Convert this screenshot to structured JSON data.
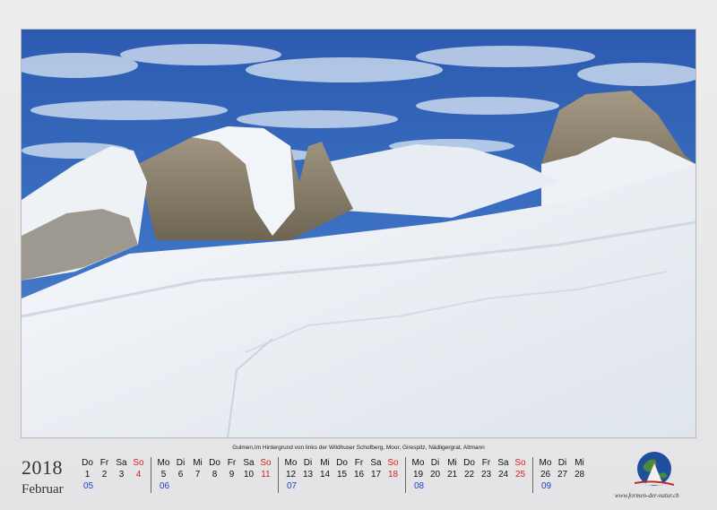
{
  "caption": "Gulmen,Im Hintergrund von links der Wildhuser Schofberg, Moor, Girespitz, Nädligergrat, Altmann",
  "year": "2018",
  "month": "Februar",
  "website": "www.formen-der-natur.ch",
  "colors": {
    "sunday": "#d91f1f",
    "week_number": "#1e3fc8"
  },
  "weeks": [
    {
      "week": "05",
      "days": [
        {
          "d": "Do",
          "n": "1"
        },
        {
          "d": "Fr",
          "n": "2"
        },
        {
          "d": "Sa",
          "n": "3"
        },
        {
          "d": "So",
          "n": "4",
          "sun": true
        }
      ]
    },
    {
      "week": "06",
      "days": [
        {
          "d": "Mo",
          "n": "5"
        },
        {
          "d": "Di",
          "n": "6"
        },
        {
          "d": "Mi",
          "n": "7"
        },
        {
          "d": "Do",
          "n": "8"
        },
        {
          "d": "Fr",
          "n": "9"
        },
        {
          "d": "Sa",
          "n": "10"
        },
        {
          "d": "So",
          "n": "11",
          "sun": true
        }
      ]
    },
    {
      "week": "07",
      "days": [
        {
          "d": "Mo",
          "n": "12"
        },
        {
          "d": "Di",
          "n": "13"
        },
        {
          "d": "Mi",
          "n": "14"
        },
        {
          "d": "Do",
          "n": "15"
        },
        {
          "d": "Fr",
          "n": "16"
        },
        {
          "d": "Sa",
          "n": "17"
        },
        {
          "d": "So",
          "n": "18",
          "sun": true
        }
      ]
    },
    {
      "week": "08",
      "days": [
        {
          "d": "Mo",
          "n": "19"
        },
        {
          "d": "Di",
          "n": "20"
        },
        {
          "d": "Mi",
          "n": "21"
        },
        {
          "d": "Do",
          "n": "22"
        },
        {
          "d": "Fr",
          "n": "23"
        },
        {
          "d": "Sa",
          "n": "24"
        },
        {
          "d": "So",
          "n": "25",
          "sun": true
        }
      ]
    },
    {
      "week": "09",
      "days": [
        {
          "d": "Mo",
          "n": "26"
        },
        {
          "d": "Di",
          "n": "27"
        },
        {
          "d": "Mi",
          "n": "28"
        }
      ]
    }
  ]
}
